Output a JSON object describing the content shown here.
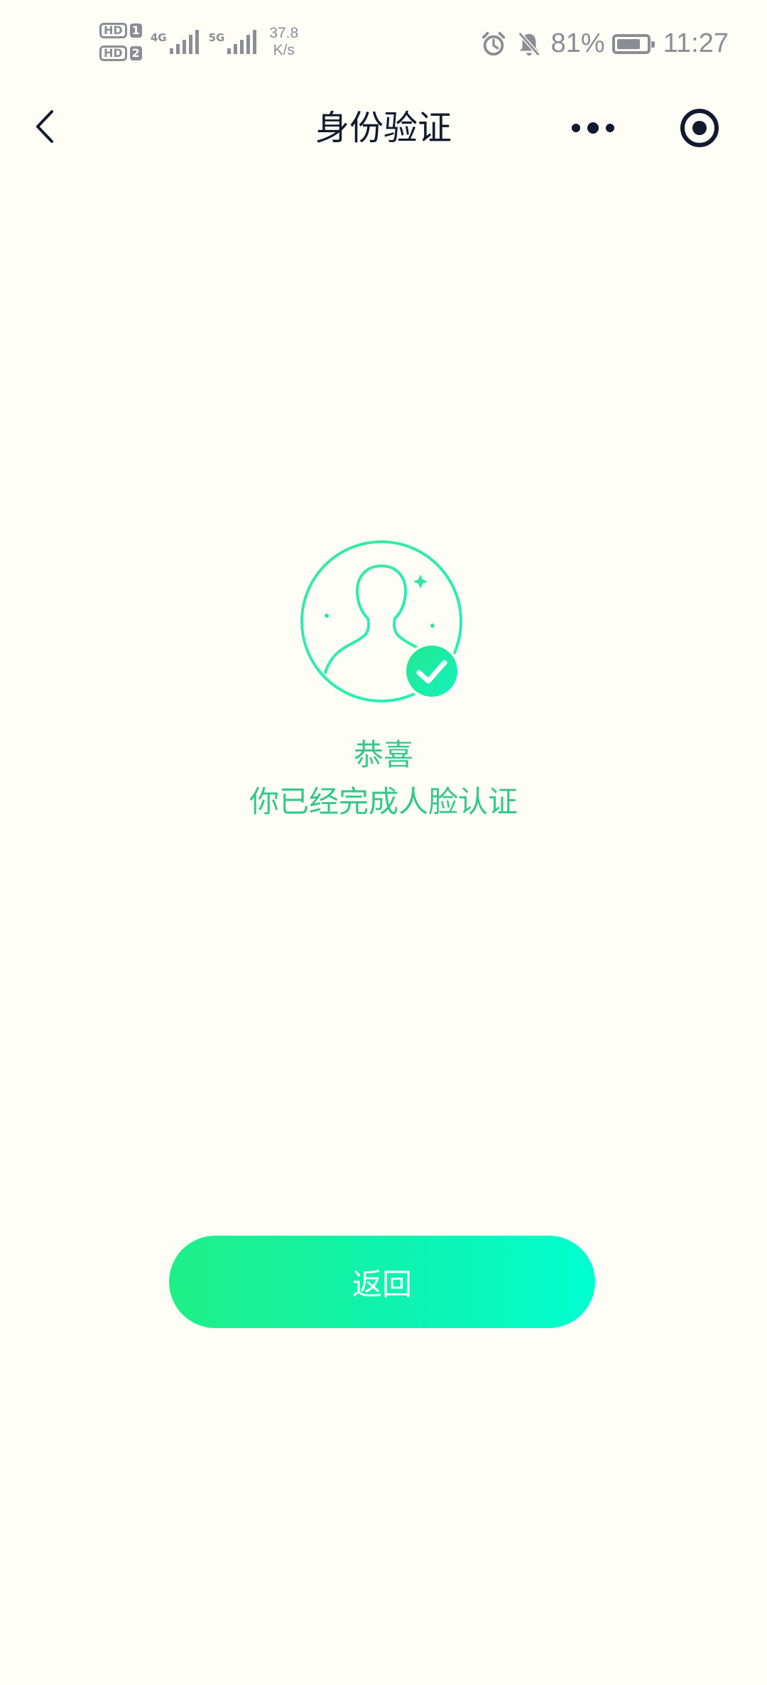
{
  "status_bar": {
    "sim1_label": "HD",
    "sim1_num": "1",
    "sim2_label": "HD",
    "sim2_num": "2",
    "net1": "4G",
    "net2": "5G",
    "speed_value": "37.8",
    "speed_unit": "K/s",
    "battery_percent": "81%",
    "battery_level": 0.81,
    "time": "11:27"
  },
  "nav": {
    "title": "身份验证",
    "back_icon": "chevron-left-icon",
    "more_icon": "more-dots-icon",
    "target_icon": "record-target-icon"
  },
  "result": {
    "heading": "恭喜",
    "message": "你已经完成人脸认证",
    "illustration_icon": "face-verified-icon"
  },
  "actions": {
    "return_label": "返回"
  },
  "colors": {
    "background": "#fefef6",
    "accent_green": "#36c78c",
    "button_gradient_start": "#1ef086",
    "button_gradient_end": "#00ffd0",
    "title_text": "#111a2e",
    "status_gray": "#8a8e94"
  }
}
